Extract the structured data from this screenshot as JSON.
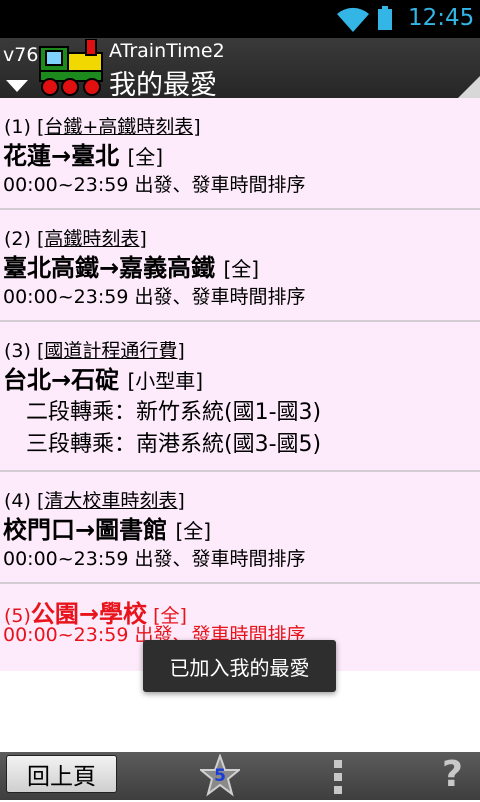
{
  "status_bar": {
    "time": "12:45",
    "accent": "#33b5e5"
  },
  "header": {
    "version": "v76",
    "app_name": "ATrainTime2",
    "page_title": "我的最愛"
  },
  "items": [
    {
      "index": "(1)",
      "service": "[台鐵+高鐵時刻表]",
      "route": "花蓮→臺北",
      "tag": "[全]",
      "detail": "00:00~23:59 出發、發車時間排序"
    },
    {
      "index": "(2)",
      "service": "[高鐵時刻表]",
      "route": "臺北高鐵→嘉義高鐵",
      "tag": "[全]",
      "detail": "00:00~23:59 出發、發車時間排序"
    },
    {
      "index": "(3)",
      "service": "[國道計程通行費]",
      "route": "台北→石碇",
      "tag": "[小型車]",
      "transfers": [
        "二段轉乘：新竹系統(國1-國3)",
        "三段轉乘：南港系統(國3-國5)"
      ]
    },
    {
      "index": "(4)",
      "service": "[清大校車時刻表]",
      "route": "校門口→圖書館",
      "tag": "[全]",
      "detail": "00:00~23:59 出發、發車時間排序"
    },
    {
      "index": "(5)",
      "route": "公園→學校",
      "tag": "[全]",
      "detail": "00:00~23:59 出發、發車時間排序",
      "color": "#e8131b"
    }
  ],
  "toast": "已加入我的最愛",
  "bottom_bar": {
    "back_label": "回上頁",
    "favorites_count": "5",
    "help_label": "?"
  }
}
